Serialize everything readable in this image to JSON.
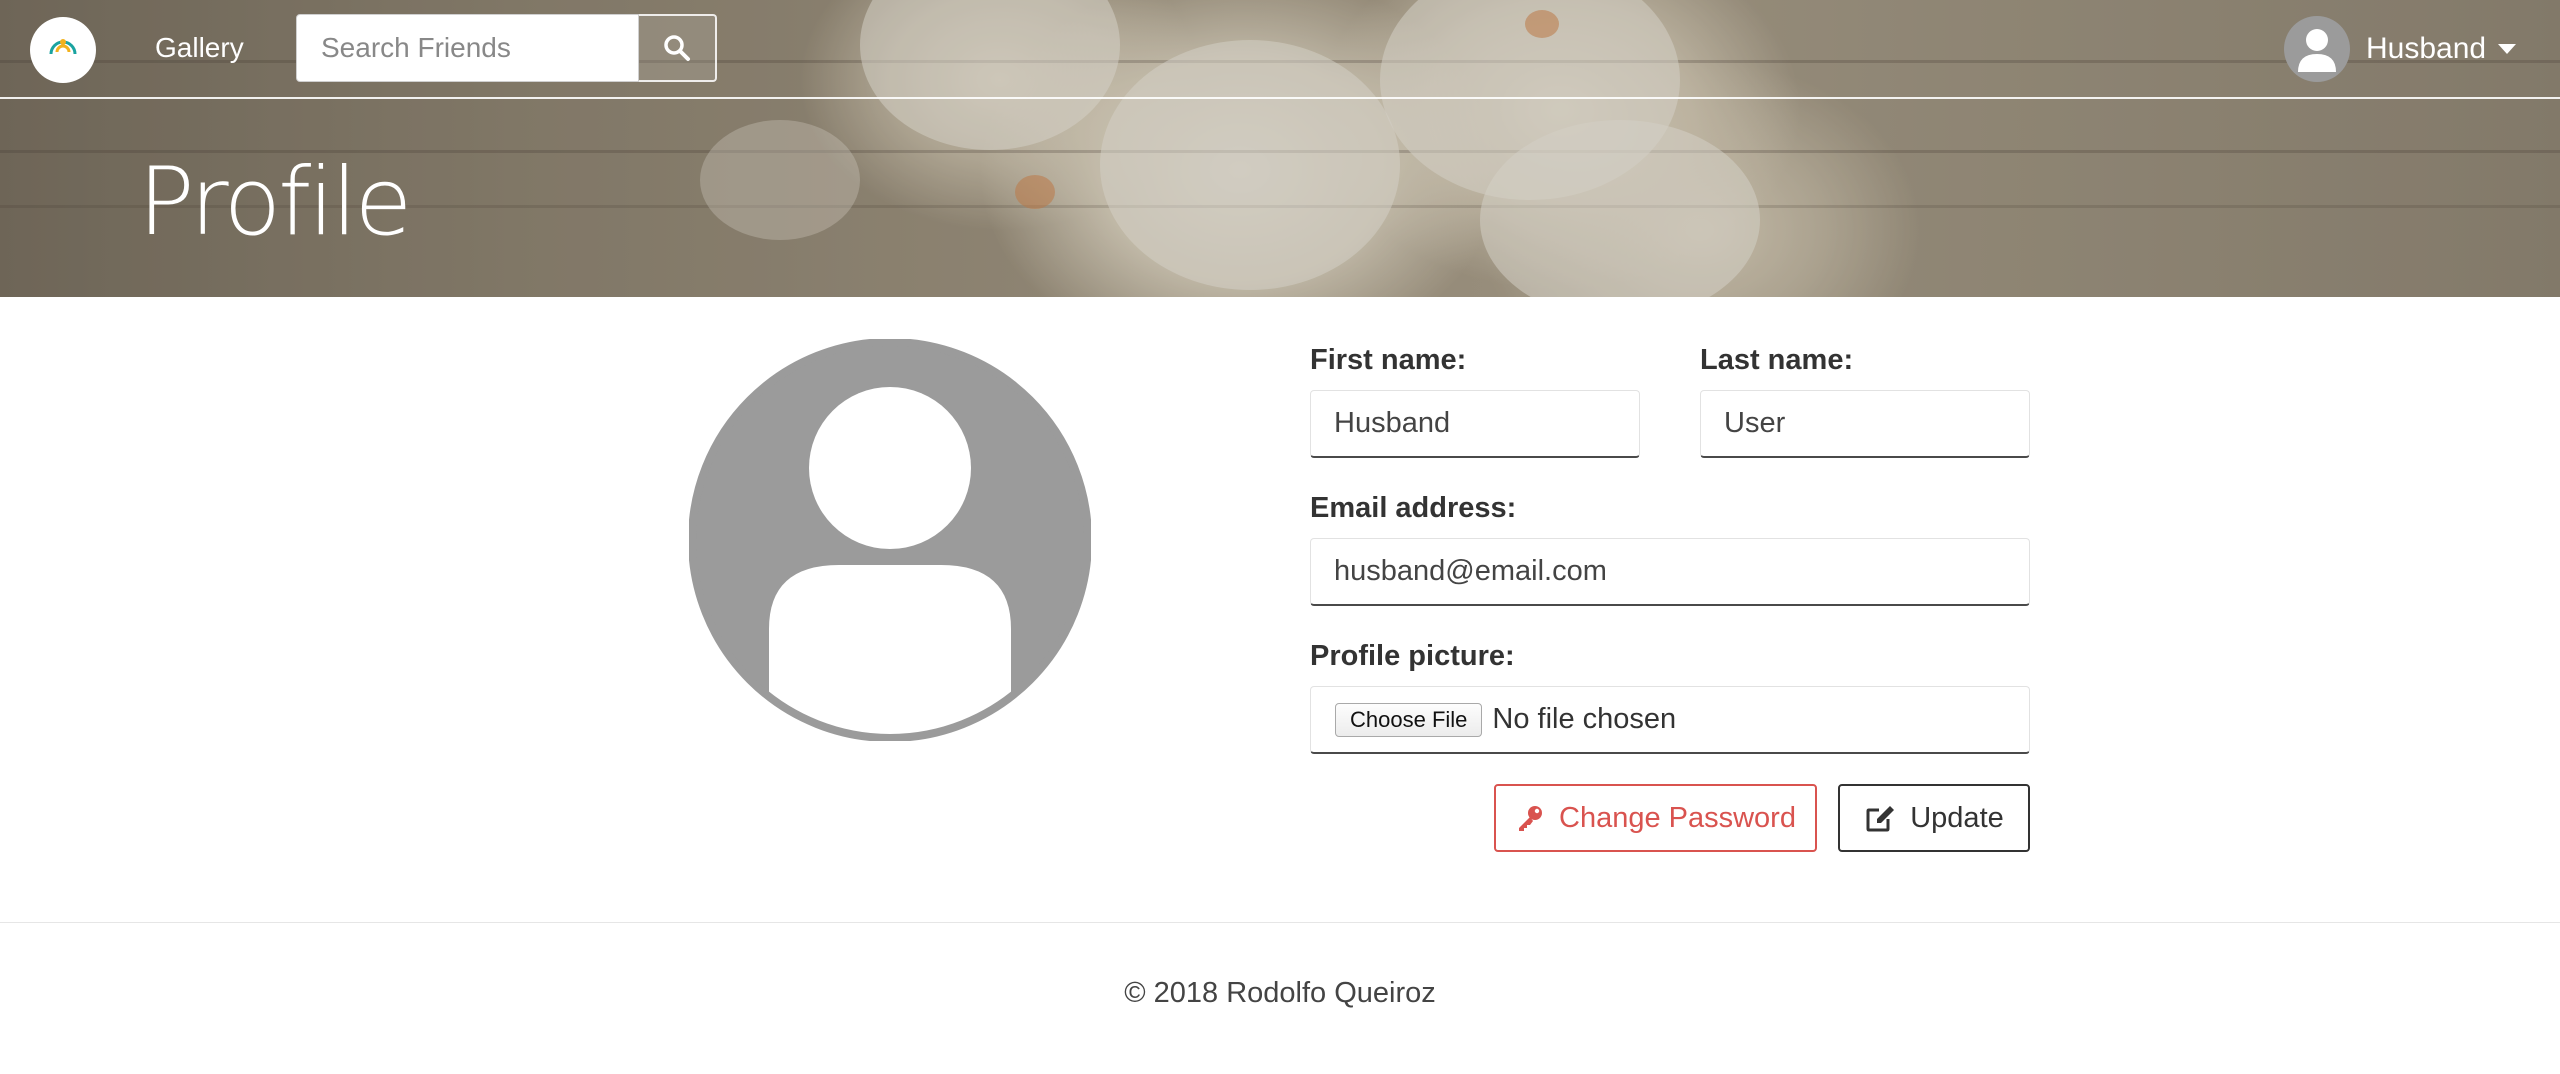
{
  "navbar": {
    "brand_icon": "ring-logo-icon",
    "gallery_label": "Gallery",
    "search_placeholder": "Search Friends",
    "search_icon": "search-icon",
    "user_name": "Husband",
    "user_icon": "user-avatar-icon"
  },
  "page": {
    "title": "Profile"
  },
  "profile": {
    "avatar_icon": "default-user-avatar-icon",
    "first_name_label": "First name:",
    "first_name_value": "Husband",
    "last_name_label": "Last name:",
    "last_name_value": "User",
    "email_label": "Email address:",
    "email_value": "husband@email.com",
    "picture_label": "Profile picture:",
    "choose_file_label": "Choose File",
    "no_file_text": "No file chosen",
    "change_password_label": "Change Password",
    "update_label": "Update"
  },
  "colors": {
    "danger": "#d9534f",
    "avatar_gray": "#9b9b9b",
    "text": "#333333"
  },
  "footer": {
    "copyright": "© 2018 Rodolfo Queiroz"
  }
}
